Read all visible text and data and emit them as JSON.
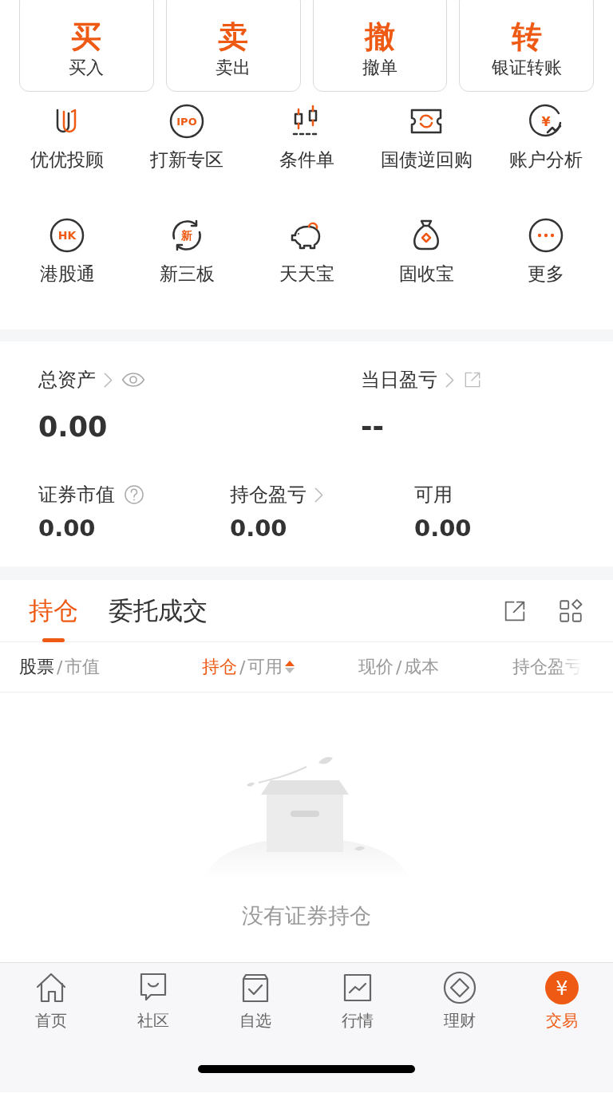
{
  "quick_actions": [
    {
      "glyph": "买",
      "label": "买入"
    },
    {
      "glyph": "卖",
      "label": "卖出"
    },
    {
      "glyph": "撤",
      "label": "撤单"
    },
    {
      "glyph": "转",
      "label": "银证转账"
    }
  ],
  "shortcuts": [
    {
      "label": "优优投顾"
    },
    {
      "label": "打新专区",
      "icon_text": "IPO"
    },
    {
      "label": "条件单"
    },
    {
      "label": "国债逆回购"
    },
    {
      "label": "账户分析",
      "icon_text": "¥"
    },
    {
      "label": "港股通",
      "icon_text": "HK"
    },
    {
      "label": "新三板",
      "icon_text": "新"
    },
    {
      "label": "天天宝"
    },
    {
      "label": "固收宝"
    },
    {
      "label": "更多"
    }
  ],
  "assets": {
    "summary": [
      {
        "label": "总资产",
        "value": "0.00"
      },
      {
        "label": "当日盈亏",
        "value": "--"
      }
    ],
    "details": [
      {
        "label": "证券市值",
        "value": "0.00"
      },
      {
        "label": "持仓盈亏",
        "value": "0.00"
      },
      {
        "label": "可用",
        "value": "0.00"
      }
    ]
  },
  "tabs": [
    {
      "label": "持仓",
      "selected": true
    },
    {
      "label": "委托成交",
      "selected": false
    }
  ],
  "columns": [
    {
      "primary": "股票",
      "separator": "/",
      "secondary": "市值",
      "sorted": false
    },
    {
      "primary": "持仓",
      "separator": "/",
      "secondary": "可用",
      "sorted": true
    },
    {
      "primary": "现价",
      "separator": "/",
      "secondary": "成本",
      "sorted": false
    },
    {
      "primary": "持仓盈亏",
      "sorted": false
    }
  ],
  "empty_message": "没有证券持仓",
  "nav": [
    {
      "label": "首页",
      "selected": false
    },
    {
      "label": "社区",
      "selected": false
    },
    {
      "label": "自选",
      "selected": false
    },
    {
      "label": "行情",
      "selected": false
    },
    {
      "label": "理财",
      "selected": false
    },
    {
      "label": "交易",
      "selected": true,
      "icon_text": "¥"
    }
  ]
}
